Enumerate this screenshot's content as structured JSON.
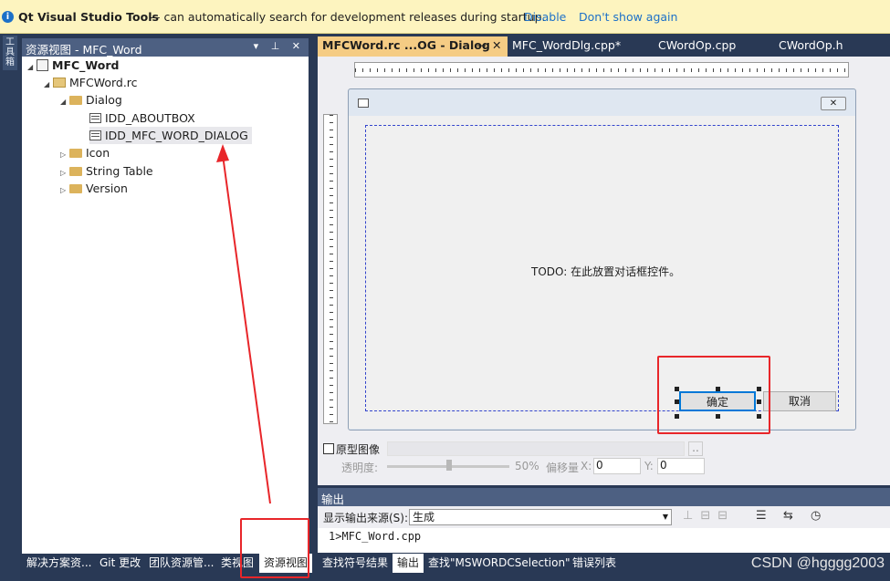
{
  "infobar": {
    "icon": "info-icon",
    "product": "Qt Visual Studio Tools",
    "message": "— can automatically search for development releases during startup.",
    "disable": "Disable",
    "dont_show": "Don't show again"
  },
  "toolbox_strip": {
    "label": "工具箱"
  },
  "resource_view": {
    "title": "资源视图 - MFC_Word",
    "header_buttons": "▾ ⊥ ✕",
    "tree": [
      {
        "label": "MFC_Word",
        "icon": "project-icon",
        "expanded": true
      },
      {
        "label": "MFCWord.rc",
        "icon": "rc-file-icon",
        "expanded": true
      },
      {
        "label": "Dialog",
        "icon": "folder-icon",
        "expanded": true
      },
      {
        "label": "IDD_ABOUTBOX",
        "icon": "dialog-resource-icon"
      },
      {
        "label": "IDD_MFC_WORD_DIALOG",
        "icon": "dialog-resource-icon",
        "selected": true
      },
      {
        "label": "Icon",
        "icon": "folder-icon",
        "expanded": false
      },
      {
        "label": "String Table",
        "icon": "folder-icon",
        "expanded": false
      },
      {
        "label": "Version",
        "icon": "folder-icon",
        "expanded": false
      }
    ]
  },
  "left_bottom_tabs": [
    "解决方案资...",
    "Git 更改",
    "团队资源管...",
    "类视图",
    "资源视图"
  ],
  "doc_tabs": [
    {
      "label": "MFCWord.rc ...OG - Dialog",
      "active": true
    },
    {
      "label": "MFC_WordDlg.cpp*"
    },
    {
      "label": "CWordOp.cpp"
    },
    {
      "label": "CWordOp.h"
    }
  ],
  "dialog": {
    "todo_text": "TODO: 在此放置对话框控件。",
    "ok_label": "确定",
    "cancel_label": "取消"
  },
  "prototype": {
    "checkbox_label": "原型图像",
    "transparency_label": "透明度:",
    "transparency_value": "50%",
    "offset_label": "偏移量",
    "x_label": "X:",
    "x_value": "0",
    "y_label": "Y:",
    "y_value": "0",
    "browse": ".."
  },
  "output": {
    "title": "输出",
    "source_label": "显示输出来源(S):",
    "source_value": "生成",
    "text": "1>MFC_Word.cpp"
  },
  "right_bottom_tabs": [
    "查找符号结果",
    "输出",
    "查找\"MSWORDCSelection\"",
    "错误列表"
  ],
  "watermark": "CSDN @hgggg2003",
  "colors": {
    "annotation_red": "#e8262a",
    "active_tab": "#f5cc84",
    "panel_header": "#4d6082"
  }
}
